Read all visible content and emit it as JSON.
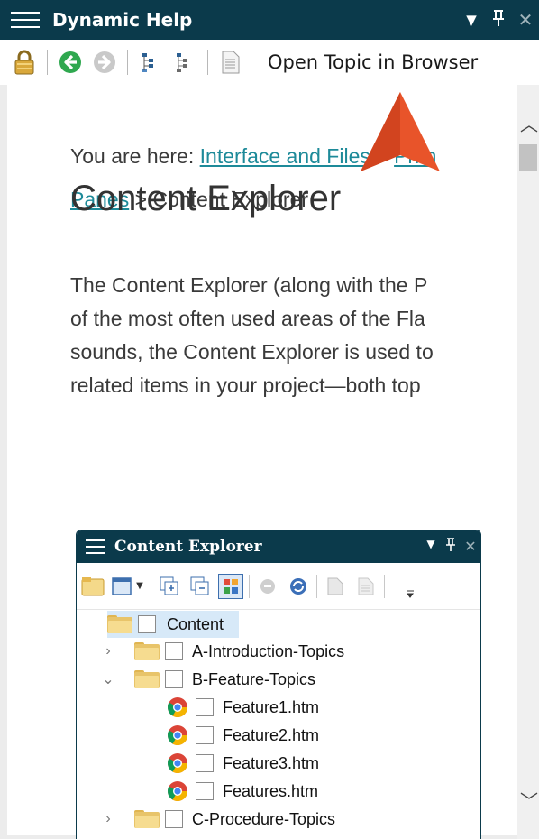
{
  "panel": {
    "title": "Dynamic Help",
    "controls": {
      "dropdown": "▼",
      "pin": "ᚹ",
      "close": "✕"
    }
  },
  "toolbar": {
    "open_topic_label": "Open Topic in Browser",
    "icons": [
      "lock-icon",
      "back-icon",
      "forward-icon",
      "sync-toc-icon",
      "toc-icon",
      "page-icon"
    ]
  },
  "breadcrumb": {
    "prefix": "You are here: ",
    "link1": "Interface and Files",
    "sep1": " > ",
    "link2": "Prim",
    "link3": "Panes",
    "sep2": " > ",
    "current": "Content Explorer"
  },
  "heading": "Content Explorer",
  "paragraph": [
    "The Content Explorer (along with the P",
    "of the most often used areas of the Fla",
    "sounds, the Content Explorer is used to",
    "related items in your project—both top"
  ],
  "content_explorer": {
    "title": "Content Explorer",
    "controls": {
      "dropdown": "▼",
      "pin": "ᚹ",
      "close": "✕"
    },
    "tree": [
      {
        "label": "Content",
        "type": "folder-open",
        "level": 0,
        "expander": "",
        "selected": true
      },
      {
        "label": "A-Introduction-Topics",
        "type": "folder",
        "level": 1,
        "expander": "›"
      },
      {
        "label": "B-Feature-Topics",
        "type": "folder-open",
        "level": 1,
        "expander": "⌄"
      },
      {
        "label": "Feature1.htm",
        "type": "file",
        "level": 2,
        "expander": ""
      },
      {
        "label": "Feature2.htm",
        "type": "file",
        "level": 2,
        "expander": ""
      },
      {
        "label": "Feature3.htm",
        "type": "file",
        "level": 2,
        "expander": ""
      },
      {
        "label": "Features.htm",
        "type": "file",
        "level": 2,
        "expander": ""
      },
      {
        "label": "C-Procedure-Topics",
        "type": "folder",
        "level": 1,
        "expander": "›"
      }
    ]
  },
  "colors": {
    "titlebar": "#0b3a4b",
    "link": "#1d8a99",
    "arrow": "#e8542a",
    "selection": "#d7e9f8"
  }
}
